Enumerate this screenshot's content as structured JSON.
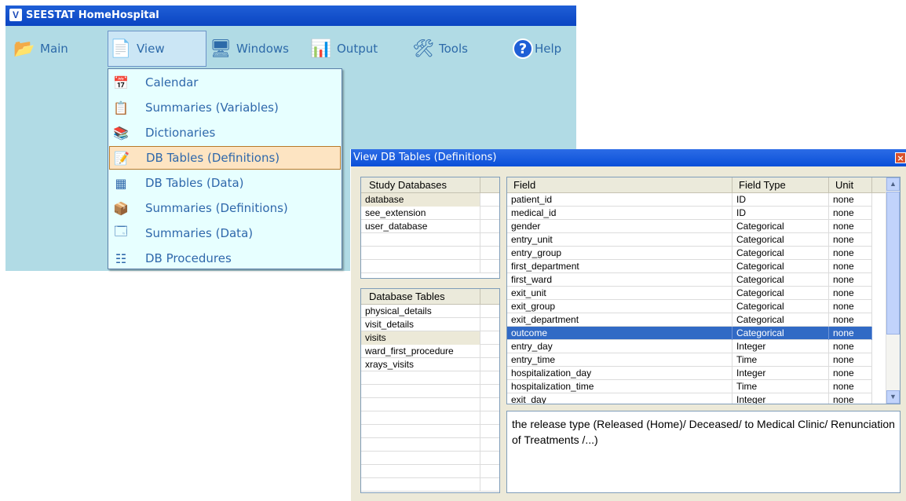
{
  "app": {
    "title": "SEESTAT HomeHospital",
    "logo_glyph": "V"
  },
  "menu": [
    {
      "label": "Main",
      "icon": "folder-icon",
      "glyph": "📂"
    },
    {
      "label": "View",
      "icon": "view-document-icon",
      "glyph": "📄"
    },
    {
      "label": "Windows",
      "icon": "windows-icon",
      "glyph": "🖥"
    },
    {
      "label": "Output",
      "icon": "output-icon",
      "glyph": "📊"
    },
    {
      "label": "Tools",
      "icon": "tools-icon",
      "glyph": "🛠"
    },
    {
      "label": "Help",
      "icon": "help-icon",
      "glyph": "?"
    }
  ],
  "view_menu": [
    {
      "label": "Calendar",
      "icon": "calendar-icon",
      "glyph": "📅"
    },
    {
      "label": "Summaries (Variables)",
      "icon": "summaries-variables-icon",
      "glyph": "📋"
    },
    {
      "label": "Dictionaries",
      "icon": "dictionaries-icon",
      "glyph": "📚"
    },
    {
      "label": "DB Tables (Definitions)",
      "icon": "db-definitions-icon",
      "glyph": "📝"
    },
    {
      "label": "DB Tables (Data)",
      "icon": "db-data-icon",
      "glyph": "▦"
    },
    {
      "label": "Summaries (Definitions)",
      "icon": "summaries-definitions-icon",
      "glyph": "📦"
    },
    {
      "label": "Summaries (Data)",
      "icon": "summaries-data-icon",
      "glyph": "🗔"
    },
    {
      "label": "DB Procedures",
      "icon": "db-procedures-icon",
      "glyph": "☷"
    }
  ],
  "dialog": {
    "title": "View DB Tables (Definitions)",
    "close_glyph": "×",
    "study_databases": {
      "header": "Study Databases",
      "items": [
        "database",
        "see_extension",
        "user_database"
      ],
      "selected": "database"
    },
    "database_tables": {
      "header": "Database Tables",
      "items": [
        "physical_details",
        "visit_details",
        "visits",
        "ward_first_procedure",
        "xrays_visits"
      ],
      "selected": "visits"
    },
    "fields_table": {
      "columns": [
        "Field",
        "Field Type",
        "Unit"
      ],
      "rows": [
        [
          "patient_id",
          "ID",
          "none"
        ],
        [
          "medical_id",
          "ID",
          "none"
        ],
        [
          "gender",
          "Categorical",
          "none"
        ],
        [
          "entry_unit",
          "Categorical",
          "none"
        ],
        [
          "entry_group",
          "Categorical",
          "none"
        ],
        [
          "first_department",
          "Categorical",
          "none"
        ],
        [
          "first_ward",
          "Categorical",
          "none"
        ],
        [
          "exit_unit",
          "Categorical",
          "none"
        ],
        [
          "exit_group",
          "Categorical",
          "none"
        ],
        [
          "exit_department",
          "Categorical",
          "none"
        ],
        [
          "outcome",
          "Categorical",
          "none"
        ],
        [
          "entry_day",
          "Integer",
          "none"
        ],
        [
          "entry_time",
          "Time",
          "none"
        ],
        [
          "hospitalization_day",
          "Integer",
          "none"
        ],
        [
          "hospitalization_time",
          "Time",
          "none"
        ],
        [
          "exit_day",
          "Integer",
          "none"
        ]
      ],
      "selected_row": "outcome"
    },
    "description": "the release type (Released (Home)/ Deceased/ to Medical Clinic/ Renunciation of Treatments /...)"
  },
  "colors": {
    "app_background": "#b1dbe5",
    "menu_text": "#2d6aa9",
    "dropdown_background": "#e7ffff",
    "dropdown_selected": "#fde4c2",
    "title_bar": "#0a45c2",
    "row_selected": "#316ac5"
  }
}
